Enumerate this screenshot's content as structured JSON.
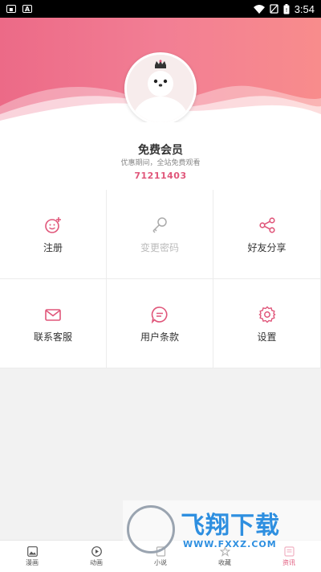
{
  "status_bar": {
    "time": "3:54",
    "left_icons": [
      "image-notification-icon",
      "a-notification-icon"
    ],
    "right_icons": [
      "wifi-icon",
      "no-sim-icon",
      "battery-icon"
    ]
  },
  "profile": {
    "member_title": "免费会员",
    "member_subtitle": "优惠期间，全站免费观看",
    "member_id": "71211403"
  },
  "menu": [
    {
      "label": "注册",
      "icon": "smile-plus-icon",
      "enabled": true
    },
    {
      "label": "变更密码",
      "icon": "key-icon",
      "enabled": false
    },
    {
      "label": "好友分享",
      "icon": "share-icon",
      "enabled": true
    },
    {
      "label": "联系客服",
      "icon": "mail-icon",
      "enabled": true
    },
    {
      "label": "用户条款",
      "icon": "message-bubble-icon",
      "enabled": true
    },
    {
      "label": "设置",
      "icon": "gear-icon",
      "enabled": true
    }
  ],
  "tabbar": [
    {
      "label": "漫画",
      "icon": "picture-icon"
    },
    {
      "label": "动画",
      "icon": "play-circle-icon"
    },
    {
      "label": "小说",
      "icon": "book-icon"
    },
    {
      "label": "收藏",
      "icon": "star-icon"
    },
    {
      "label": "资讯",
      "icon": "news-icon",
      "active": true
    }
  ],
  "watermark": {
    "text": "飞翔下载",
    "url": "WWW.FXXZ.COM"
  },
  "colors": {
    "accent": "#e0567a",
    "header_gradient_start": "#ec6a87",
    "header_gradient_end": "#f88c8c"
  }
}
